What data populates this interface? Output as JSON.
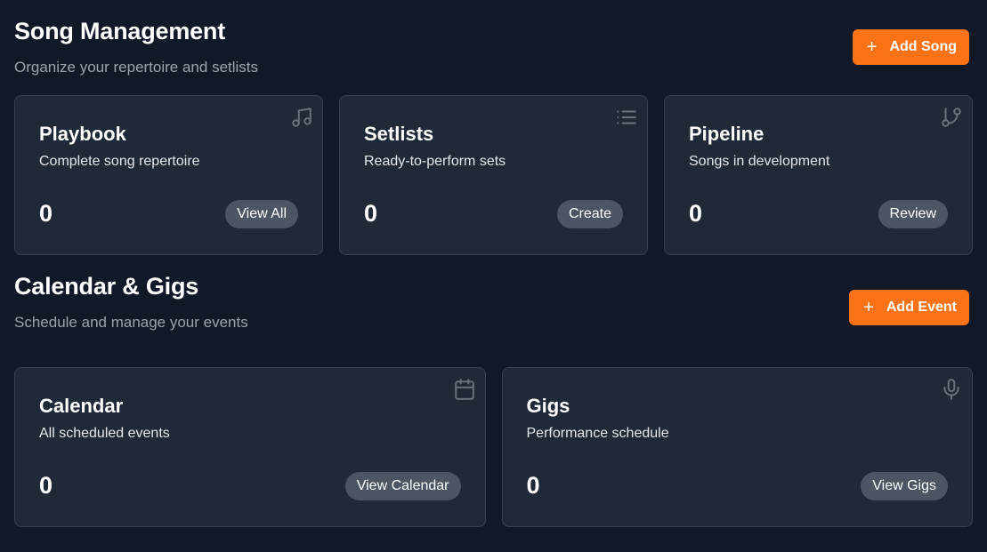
{
  "songs": {
    "title": "Song Management",
    "subtitle": "Organize your repertoire and setlists",
    "add_label": "Add Song",
    "cards": [
      {
        "title": "Playbook",
        "desc": "Complete song repertoire",
        "count": "0",
        "button": "View All",
        "icon": "music-note-icon"
      },
      {
        "title": "Setlists",
        "desc": "Ready-to-perform sets",
        "count": "0",
        "button": "Create",
        "icon": "list-icon"
      },
      {
        "title": "Pipeline",
        "desc": "Songs in development",
        "count": "0",
        "button": "Review",
        "icon": "git-branch-icon"
      }
    ]
  },
  "calendar": {
    "title": "Calendar & Gigs",
    "subtitle": "Schedule and manage your events",
    "add_label": "Add Event",
    "cards": [
      {
        "title": "Calendar",
        "desc": "All scheduled events",
        "count": "0",
        "button": "View Calendar",
        "icon": "calendar-icon"
      },
      {
        "title": "Gigs",
        "desc": "Performance schedule",
        "count": "0",
        "button": "View Gigs",
        "icon": "microphone-icon"
      }
    ]
  },
  "colors": {
    "background": "#111827",
    "card": "#1f2937",
    "accent": "#f97316",
    "pill": "#4b5563"
  }
}
